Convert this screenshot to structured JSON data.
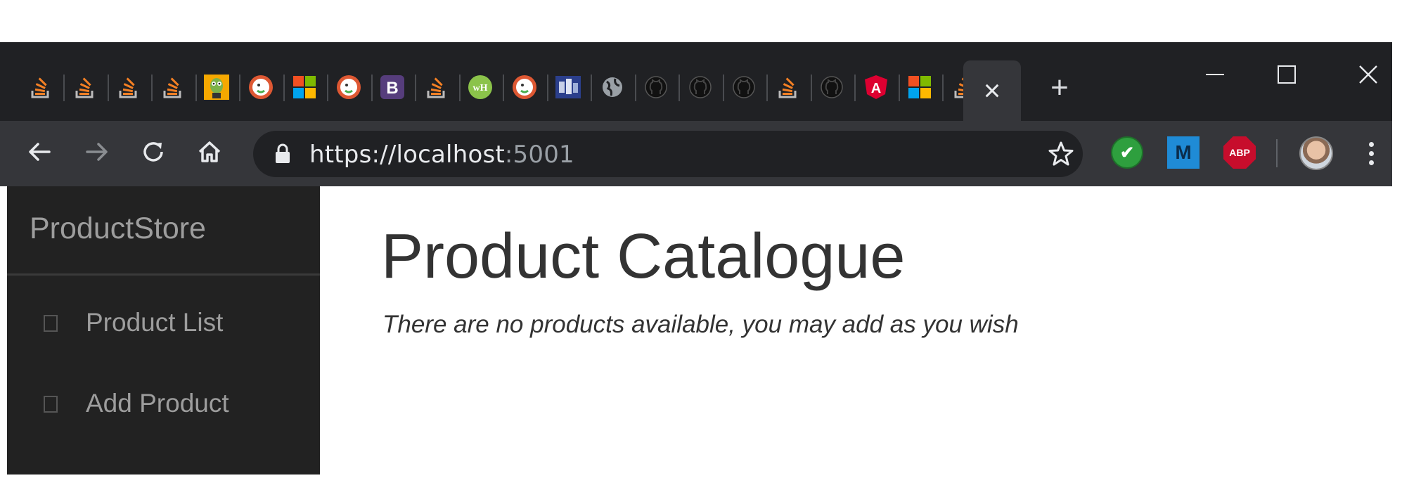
{
  "browser": {
    "tabs": [
      {
        "icon": "stackoverflow-icon",
        "color": "#f48024"
      },
      {
        "icon": "stackoverflow-icon",
        "color": "#f48024"
      },
      {
        "icon": "stackoverflow-icon",
        "color": "#f48024"
      },
      {
        "icon": "stackoverflow-icon",
        "color": "#f48024"
      },
      {
        "icon": "cartoon-character-icon",
        "color": "#f6a800"
      },
      {
        "icon": "duckduckgo-icon",
        "color": "#de5833"
      },
      {
        "icon": "microsoft-icon",
        "color": "#f25022"
      },
      {
        "icon": "duckduckgo-icon",
        "color": "#de5833"
      },
      {
        "icon": "bootstrap-icon",
        "color": "#563d7c",
        "letter": "B"
      },
      {
        "icon": "stackoverflow-icon",
        "color": "#f48024"
      },
      {
        "icon": "wh-icon",
        "color": "#8bc34a",
        "letter": "wH"
      },
      {
        "icon": "duckduckgo-icon",
        "color": "#de5833"
      },
      {
        "icon": "site-thumbnail-icon",
        "color": "#2b3f8c"
      },
      {
        "icon": "globe-icon",
        "color": "#9aa0a6"
      },
      {
        "icon": "github-icon",
        "color": "#111111"
      },
      {
        "icon": "github-icon",
        "color": "#111111"
      },
      {
        "icon": "github-icon",
        "color": "#111111"
      },
      {
        "icon": "stackoverflow-icon",
        "color": "#f48024"
      },
      {
        "icon": "github-icon",
        "color": "#111111"
      },
      {
        "icon": "angular-icon",
        "color": "#dd0031",
        "letter": "A"
      },
      {
        "icon": "microsoft-icon",
        "color": "#f25022"
      },
      {
        "icon": "stackoverflow-icon",
        "color": "#f48024"
      }
    ],
    "active_tab_close": "×",
    "new_tab": "+",
    "window_controls": {
      "minimize": "—",
      "maximize": "☐",
      "close": "✕"
    },
    "nav": {
      "back": "back-arrow-icon",
      "forward": "forward-arrow-icon",
      "reload": "reload-icon",
      "home": "home-icon"
    },
    "address": {
      "scheme": "https://",
      "host": "localhost",
      "port": ":5001",
      "lock": "lock-icon",
      "bookmark": "star-icon"
    },
    "extensions": [
      {
        "name": "checkmark-extension-icon",
        "color": "#2e9f3e",
        "glyph": "✔"
      },
      {
        "name": "m-extension-icon",
        "color": "#1f8bd6",
        "glyph": "M"
      },
      {
        "name": "adblock-plus-icon",
        "color": "#c70d2c",
        "glyph": "ABP"
      }
    ]
  },
  "sidebar": {
    "brand": "ProductStore",
    "items": [
      {
        "label": "Product List"
      },
      {
        "label": "Add Product"
      }
    ]
  },
  "main": {
    "title": "Product Catalogue",
    "empty_message": "There are no products available, you may add as you wish"
  }
}
